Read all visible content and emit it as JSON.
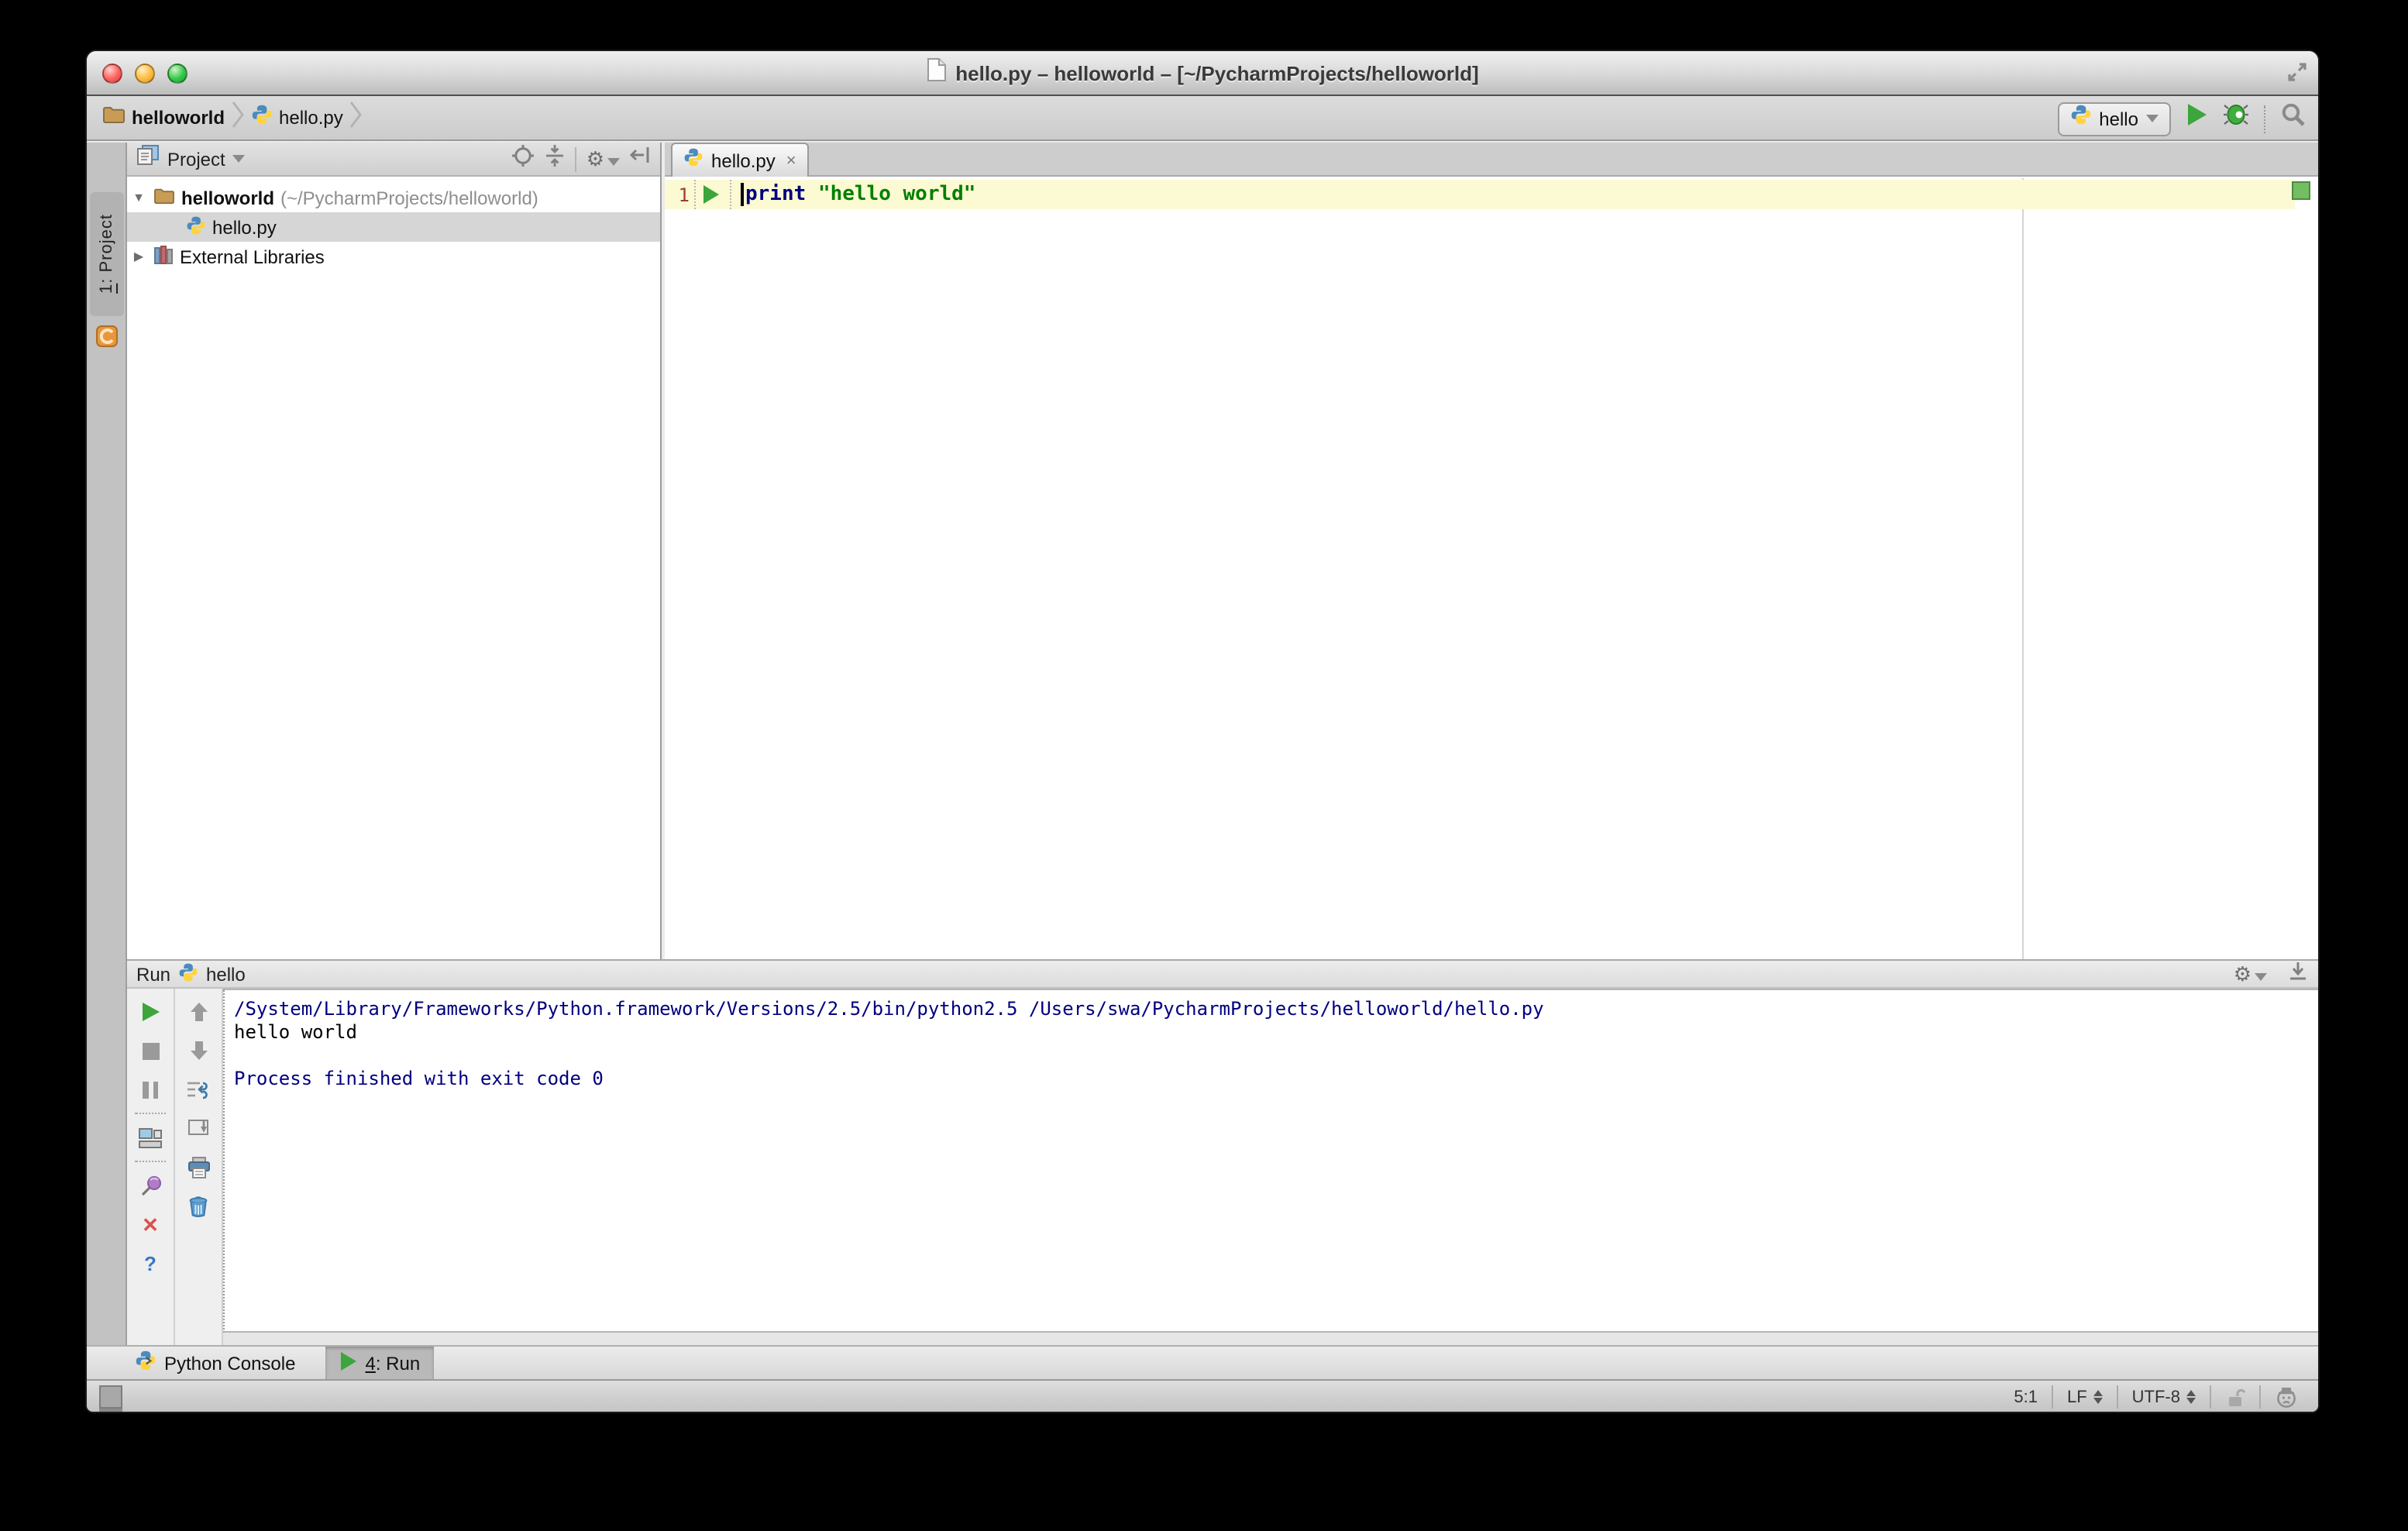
{
  "window": {
    "title": "hello.py – helloworld – [~/PycharmProjects/helloworld]"
  },
  "toolbar": {
    "breadcrumb_project": "helloworld",
    "breadcrumb_file": "hello.py",
    "run_config_label": "hello"
  },
  "left_strip": {
    "tab_number": "1",
    "tab_label": ": Project"
  },
  "project_panel": {
    "header_title": "Project",
    "rows": [
      {
        "name": "helloworld",
        "path": " (~/PycharmProjects/helloworld)"
      },
      {
        "name": "hello.py",
        "path": ""
      },
      {
        "name": "External Libraries",
        "path": ""
      }
    ]
  },
  "editor": {
    "tab_label": "hello.py",
    "tab_close": "×",
    "line_number": "1",
    "code_keyword": "print ",
    "code_string": "\"hello world\""
  },
  "run_panel": {
    "header_label": "Run",
    "header_config": "hello",
    "console": [
      "/System/Library/Frameworks/Python.framework/Versions/2.5/bin/python2.5 /Users/swa/PycharmProjects/helloworld/hello.py",
      "hello world",
      "",
      "Process finished with exit code 0"
    ]
  },
  "tool_window_bar": {
    "python_console_label": "Python Console",
    "run_tab_number": "4",
    "run_tab_label": ": Run"
  },
  "status_bar": {
    "caret_position": "5:1",
    "line_separator": "LF",
    "encoding": "UTF-8"
  },
  "icons": {
    "gear": "⚙",
    "tree_expanded": "▼",
    "tree_collapsed": "▶"
  },
  "colors": {
    "run_green": "#3ca53c",
    "keyword": "#000080",
    "string": "#008000",
    "console_info": "#000080",
    "console_output": "#000000",
    "line_highlight": "#fcfad2",
    "line_number": "#a03b2e",
    "indicator_green": "#72be61"
  }
}
